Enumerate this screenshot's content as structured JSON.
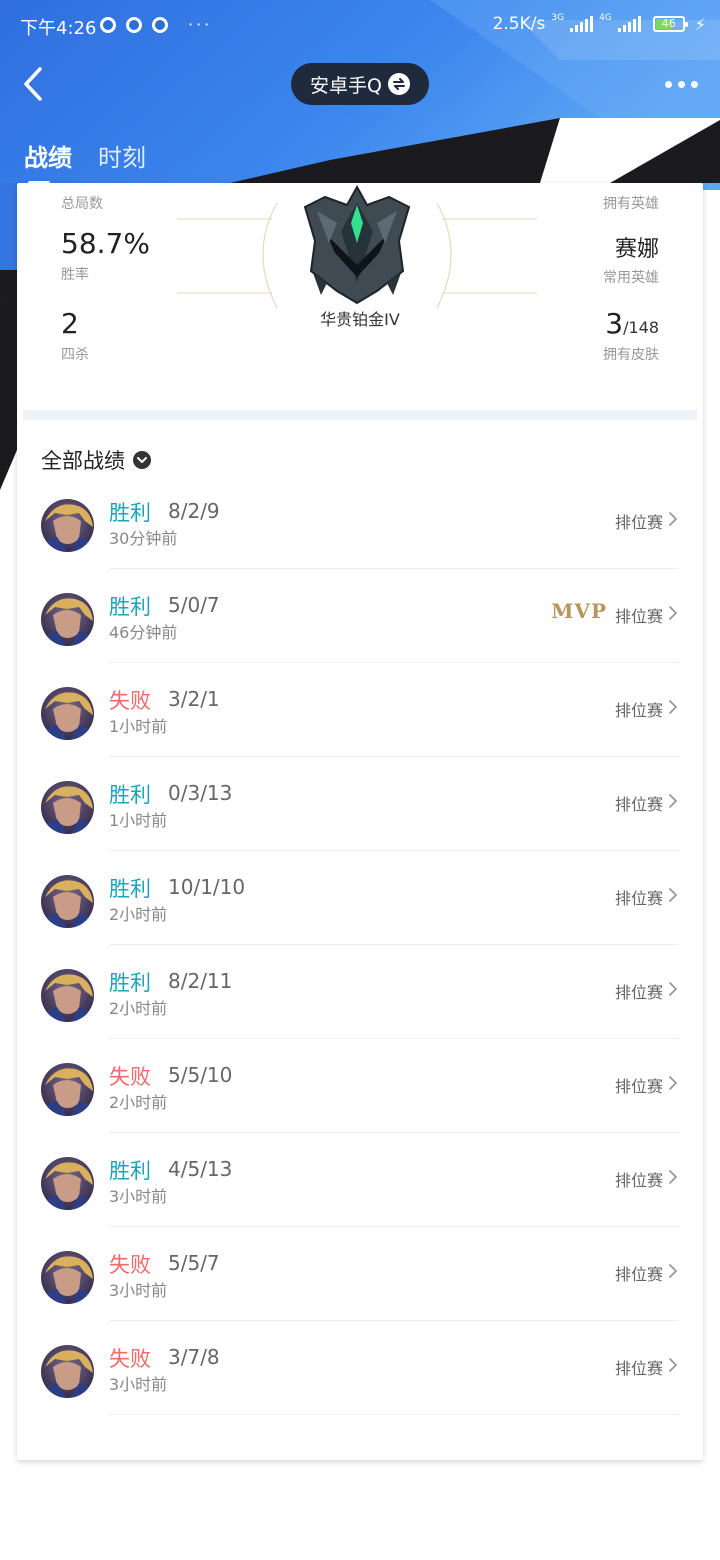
{
  "status_bar": {
    "time": "下午4:26",
    "net_speed": "2.5K/s",
    "net_tag_1": "3G",
    "net_tag_2": "4G",
    "battery": "46",
    "more": "···"
  },
  "nav": {
    "account": "安卓手Q"
  },
  "tabs": [
    {
      "label": "战绩",
      "active": true
    },
    {
      "label": "时刻",
      "active": false
    }
  ],
  "summary": {
    "total_games_label": "总局数",
    "win_rate": "58.7%",
    "win_rate_label": "胜率",
    "quadra_kills": "2",
    "quadra_kills_label": "四杀",
    "owned_heroes_label": "拥有英雄",
    "main_hero": "赛娜",
    "main_hero_label": "常用英雄",
    "skins_owned": "3",
    "skins_total": "/148",
    "skins_label": "拥有皮肤",
    "rank": "华贵铂金IV"
  },
  "section": {
    "title": "全部战绩"
  },
  "matches": [
    {
      "result": "胜利",
      "outcome": "win",
      "kda": "8/2/9",
      "time_ago": "30分钟前",
      "mode": "排位赛",
      "mvp": ""
    },
    {
      "result": "胜利",
      "outcome": "win",
      "kda": "5/0/7",
      "time_ago": "46分钟前",
      "mode": "排位赛",
      "mvp": "MVP"
    },
    {
      "result": "失败",
      "outcome": "lose",
      "kda": "3/2/1",
      "time_ago": "1小时前",
      "mode": "排位赛",
      "mvp": ""
    },
    {
      "result": "胜利",
      "outcome": "win",
      "kda": "0/3/13",
      "time_ago": "1小时前",
      "mode": "排位赛",
      "mvp": ""
    },
    {
      "result": "胜利",
      "outcome": "win",
      "kda": "10/1/10",
      "time_ago": "2小时前",
      "mode": "排位赛",
      "mvp": ""
    },
    {
      "result": "胜利",
      "outcome": "win",
      "kda": "8/2/11",
      "time_ago": "2小时前",
      "mode": "排位赛",
      "mvp": ""
    },
    {
      "result": "失败",
      "outcome": "lose",
      "kda": "5/5/10",
      "time_ago": "2小时前",
      "mode": "排位赛",
      "mvp": ""
    },
    {
      "result": "胜利",
      "outcome": "win",
      "kda": "4/5/13",
      "time_ago": "3小时前",
      "mode": "排位赛",
      "mvp": ""
    },
    {
      "result": "失败",
      "outcome": "lose",
      "kda": "5/5/7",
      "time_ago": "3小时前",
      "mode": "排位赛",
      "mvp": ""
    },
    {
      "result": "失败",
      "outcome": "lose",
      "kda": "3/7/8",
      "time_ago": "3小时前",
      "mode": "排位赛",
      "mvp": ""
    }
  ],
  "colors": {
    "win": "#1aa5b8",
    "lose": "#f06a6a",
    "mvp": "#b8955a",
    "header_blue": "#3b82e8",
    "header_dark": "#1b1b1f"
  }
}
